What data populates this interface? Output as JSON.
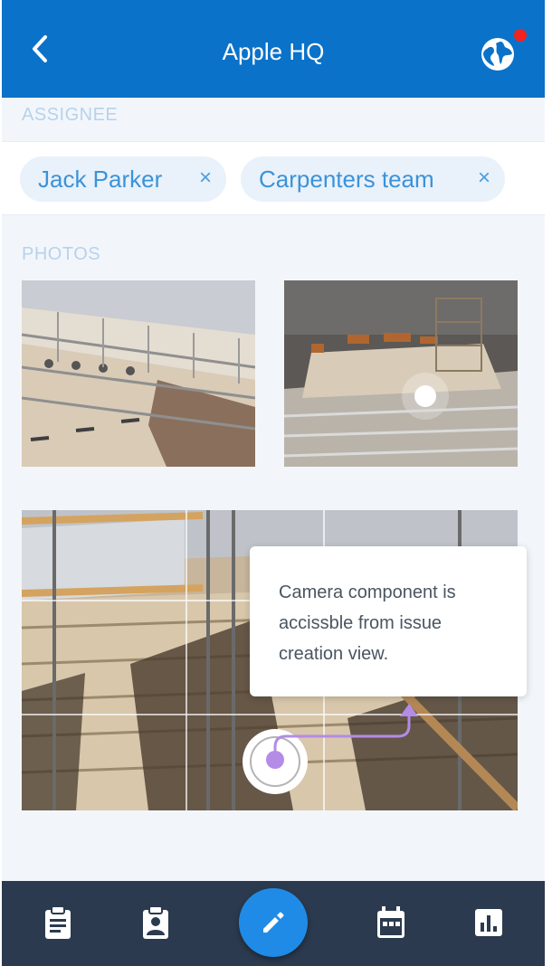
{
  "header": {
    "title": "Apple HQ",
    "back_icon": "chevron-left-icon",
    "globe_icon": "globe-icon",
    "has_notification": true,
    "brand_color": "#0a72c9",
    "notification_color": "#f2231f"
  },
  "assignee": {
    "label": "ASSIGNEE",
    "chips": [
      {
        "label": "Jack Parker",
        "remove": "×"
      },
      {
        "label": "Carpenters team",
        "remove": "×"
      }
    ]
  },
  "photos": {
    "label": "PHOTOS",
    "items": [
      {
        "description": "construction-stairs-photo"
      },
      {
        "description": "construction-hall-photo"
      }
    ]
  },
  "camera": {
    "tooltip": "Camera component is accissble from issue creation view.",
    "accent_color": "#b48be6"
  },
  "bottom_nav": {
    "items": [
      {
        "icon": "clipboard-icon"
      },
      {
        "icon": "contact-badge-icon"
      },
      {
        "icon": "pencil-icon",
        "primary": true
      },
      {
        "icon": "calendar-icon"
      },
      {
        "icon": "bar-chart-icon"
      }
    ],
    "background": "#2b3a4e",
    "fab_color": "#1f8be6"
  }
}
